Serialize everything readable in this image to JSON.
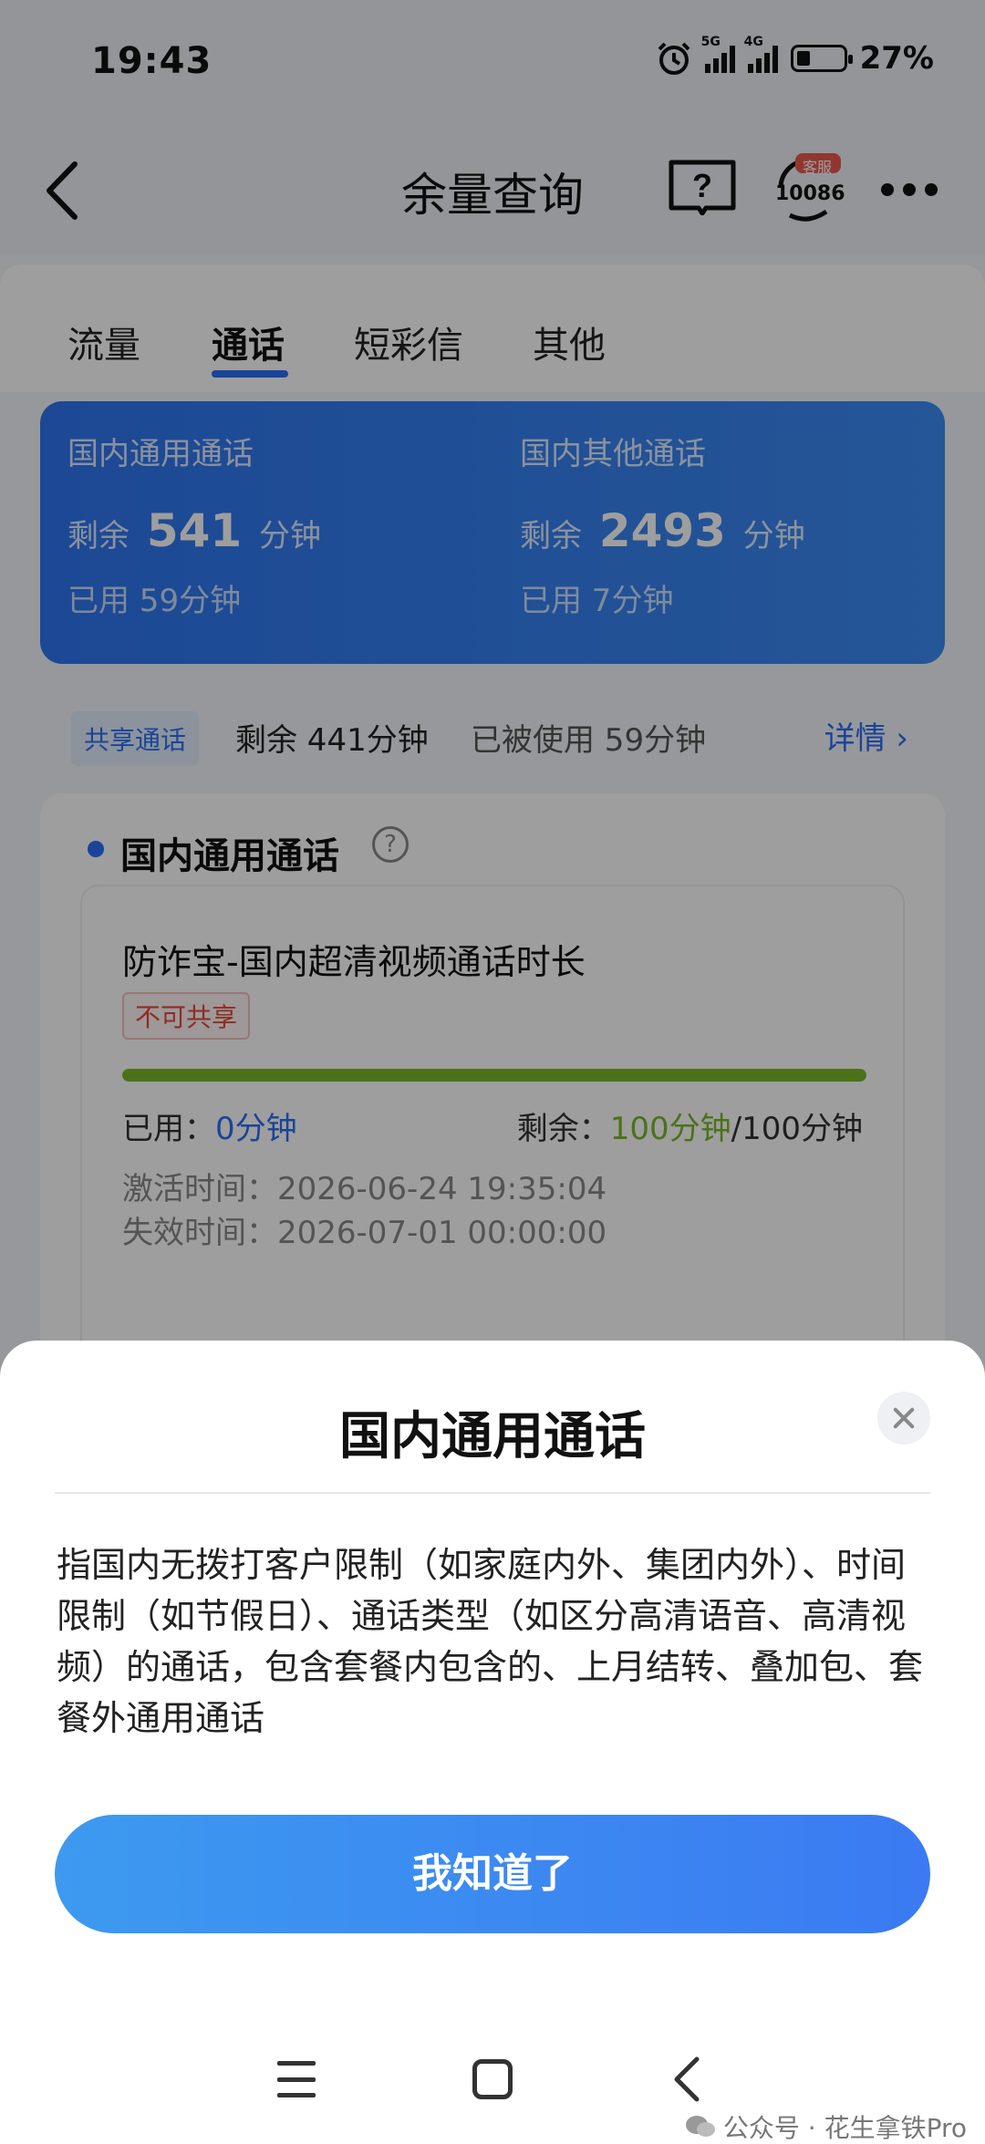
{
  "status_bar": {
    "time": "19:43",
    "signal_5g": "5G",
    "signal_4g": "4G",
    "battery_percent": "27%",
    "battery_level": 0.27
  },
  "header": {
    "title": "余量查询",
    "customer_service_badge": "客服",
    "customer_service_number": "10086"
  },
  "tabs": [
    {
      "label": "流量",
      "active": false
    },
    {
      "label": "通话",
      "active": true
    },
    {
      "label": "短彩信",
      "active": false
    },
    {
      "label": "其他",
      "active": false
    }
  ],
  "summary": {
    "domestic_general": {
      "title": "国内通用通话",
      "remain_label": "剩余",
      "remain_value": "541",
      "remain_unit": "分钟",
      "used": "已用  59分钟"
    },
    "domestic_other": {
      "title": "国内其他通话",
      "remain_label": "剩余",
      "remain_value": "2493",
      "remain_unit": "分钟",
      "used": "已用  7分钟"
    }
  },
  "shared": {
    "badge": "共享通话",
    "remain": "剩余 441分钟",
    "used": "已被使用 59分钟",
    "detail_link": "详情 ›"
  },
  "detail": {
    "section_title": "国内通用通话",
    "help_symbol": "?",
    "package_name": "防诈宝-国内超清视频通话时长",
    "tag": "不可共享",
    "used_label": "已用：",
    "used_value": "0分钟",
    "remain_label": "剩余：",
    "remain_value": "100分钟",
    "remain_total": "/100分钟",
    "remaining_fraction": 1.0,
    "activate_time": "激活时间：2026-06-24 19:35:04",
    "expire_time": "失效时间：2026-07-01 00:00:00"
  },
  "sheet": {
    "title": "国内通用通话",
    "body": "指国内无拨打客户限制（如家庭内外、集团内外）、时间限制（如节假日）、通话类型（如区分高清语音、高清视频）的通话，包含套餐内包含的、上月结转、叠加包、套餐外通用通话",
    "ok_label": "我知道了"
  },
  "watermark": "公众号 · 花生拿铁Pro",
  "colors": {
    "accent": "#2a6ef5",
    "progress": "#7ab929",
    "tag": "#e24a3b"
  }
}
